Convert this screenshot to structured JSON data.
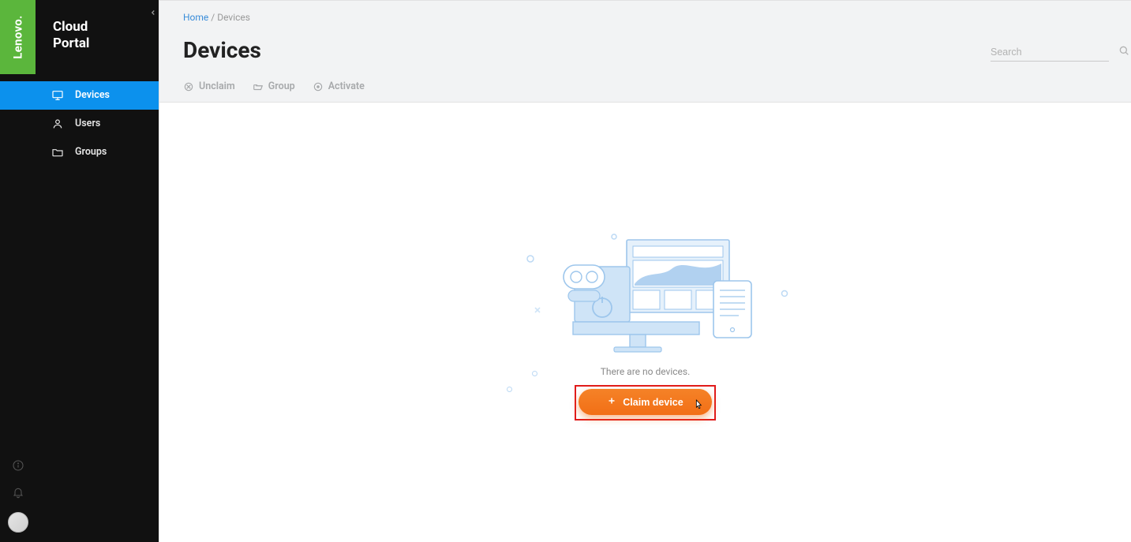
{
  "brand": {
    "logo": "Lenovo.",
    "title_line1": "Cloud",
    "title_line2": "Portal"
  },
  "sidebar": {
    "items": [
      {
        "label": "Devices",
        "icon": "monitor-icon",
        "active": true
      },
      {
        "label": "Users",
        "icon": "user-icon",
        "active": false
      },
      {
        "label": "Groups",
        "icon": "folder-icon",
        "active": false
      }
    ]
  },
  "breadcrumb": {
    "home": "Home",
    "sep": "/",
    "current": "Devices"
  },
  "page": {
    "title": "Devices"
  },
  "toolbar": {
    "unclaim": "Unclaim",
    "group": "Group",
    "activate": "Activate"
  },
  "search": {
    "placeholder": "Search"
  },
  "empty": {
    "text": "There are no devices.",
    "claim_label": "Claim device"
  }
}
